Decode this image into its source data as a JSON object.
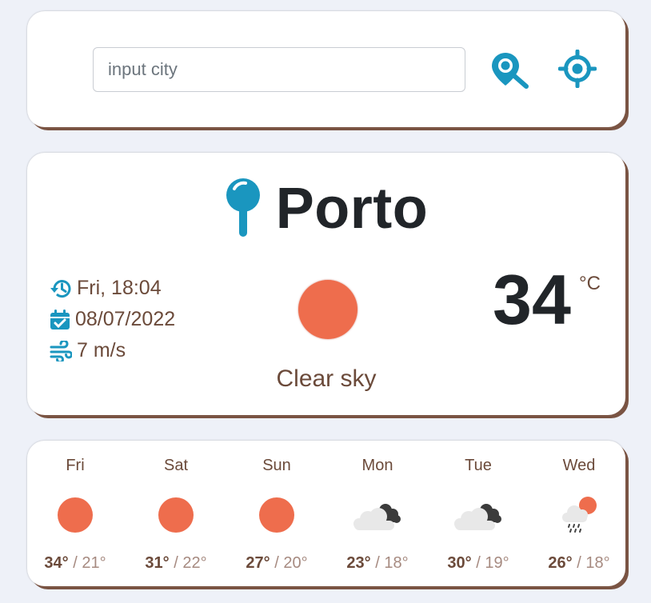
{
  "search": {
    "placeholder": "input city",
    "value": ""
  },
  "current": {
    "city": "Porto",
    "time": "Fri, 18:04",
    "date": "08/07/2022",
    "wind": "7 m/s",
    "temperature": "34",
    "unit": "°C",
    "condition": "Clear sky",
    "icon": "sun-icon"
  },
  "forecast": [
    {
      "day": "Fri",
      "high": "34°",
      "low": "21°",
      "icon": "sun-icon"
    },
    {
      "day": "Sat",
      "high": "31°",
      "low": "22°",
      "icon": "sun-icon"
    },
    {
      "day": "Sun",
      "high": "27°",
      "low": "20°",
      "icon": "sun-icon"
    },
    {
      "day": "Mon",
      "high": "23°",
      "low": "18°",
      "icon": "broken-clouds-icon"
    },
    {
      "day": "Tue",
      "high": "30°",
      "low": "19°",
      "icon": "broken-clouds-icon"
    },
    {
      "day": "Wed",
      "high": "26°",
      "low": "18°",
      "icon": "rain-sun-icon"
    }
  ],
  "colors": {
    "accent": "#1a96bf",
    "sun": "#ee6d4d",
    "text_brown": "#6b4a3a",
    "card_shadow": "#7a5443"
  }
}
